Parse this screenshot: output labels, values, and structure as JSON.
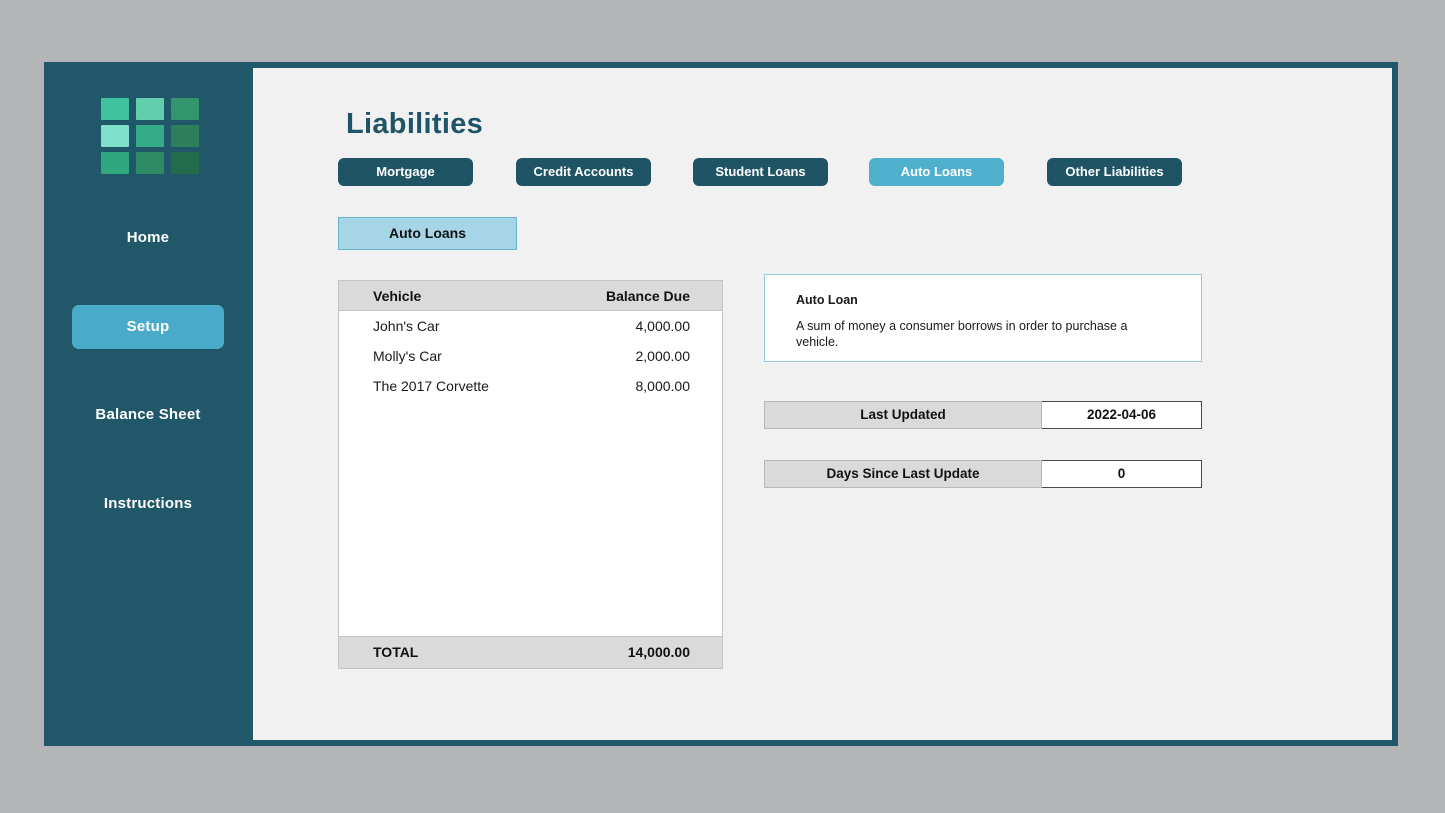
{
  "app": {
    "frame_color": "#20586a",
    "page_background": "#b4b5b7",
    "content_background": "#f1f1f1"
  },
  "sidebar": {
    "logo": {
      "name": "grid-logo",
      "tiles": [
        "#3fc19d",
        "#63ceab",
        "#33956e",
        "#7fe0cb",
        "#35ab87",
        "#2e7e5c",
        "#2fa87f",
        "#2f8a66",
        "#236b4d"
      ]
    },
    "items": [
      {
        "label": "Home",
        "active": false
      },
      {
        "label": "Setup",
        "active": true
      },
      {
        "label": "Balance Sheet",
        "active": false
      },
      {
        "label": "Instructions",
        "active": false
      }
    ],
    "active_color": "#49abc9"
  },
  "main": {
    "title": "Liabilities",
    "title_color": "#1e5467",
    "tabs": [
      {
        "label": "Mortgage",
        "active": false
      },
      {
        "label": "Credit Accounts",
        "active": false
      },
      {
        "label": "Student Loans",
        "active": false
      },
      {
        "label": "Auto Loans",
        "active": true
      },
      {
        "label": "Other Liabilities",
        "active": false
      }
    ],
    "tab_color": "#1f5465",
    "tab_active_color": "#4fb0cd",
    "sub_tab": {
      "label": "Auto Loans",
      "background": "#a5d5e6",
      "border": "#6ab4cd"
    }
  },
  "table": {
    "columns": [
      "Vehicle",
      "Balance Due"
    ],
    "rows": [
      {
        "vehicle": "John's Car",
        "balance": "4,000.00"
      },
      {
        "vehicle": "Molly's Car",
        "balance": "2,000.00"
      },
      {
        "vehicle": "The 2017 Corvette",
        "balance": "8,000.00"
      }
    ],
    "total_label": "TOTAL",
    "total_value": "14,000.00"
  },
  "definition": {
    "title": "Auto Loan",
    "text": "A sum of money a consumer borrows in order to purchase a vehicle."
  },
  "info_rows": [
    {
      "label": "Last Updated",
      "value": "2022-04-06"
    },
    {
      "label": "Days Since Last Update",
      "value": "0"
    }
  ]
}
